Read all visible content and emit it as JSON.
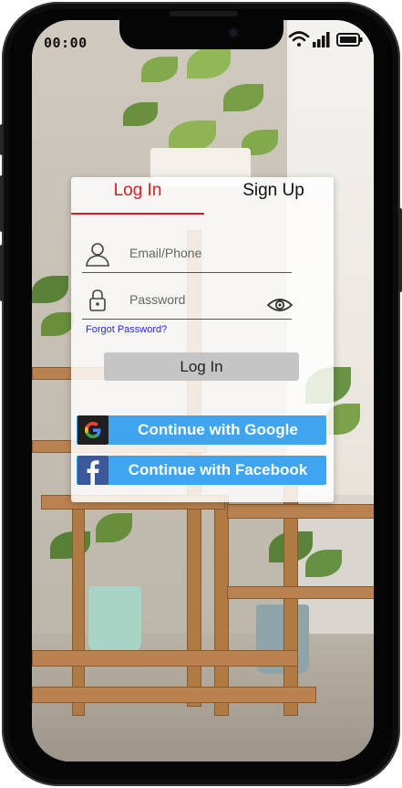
{
  "status_bar": {
    "time": "00:00",
    "icons": [
      "wifi-icon",
      "signal-icon",
      "battery-icon"
    ]
  },
  "tabs": [
    {
      "label": "Log In",
      "active": true
    },
    {
      "label": "Sign Up",
      "active": false
    }
  ],
  "form": {
    "email_placeholder": "Email/Phone",
    "password_placeholder": "Password",
    "forgot_label": "Forgot Password?",
    "login_label": "Log In"
  },
  "social": {
    "google_label": "Continue with Google",
    "facebook_label": "Continue with Facebook"
  },
  "colors": {
    "accent_red": "#d32020",
    "social_blue": "#3fa5f0",
    "link_blue": "#2a2ad0",
    "facebook_blue": "#3b5998"
  }
}
